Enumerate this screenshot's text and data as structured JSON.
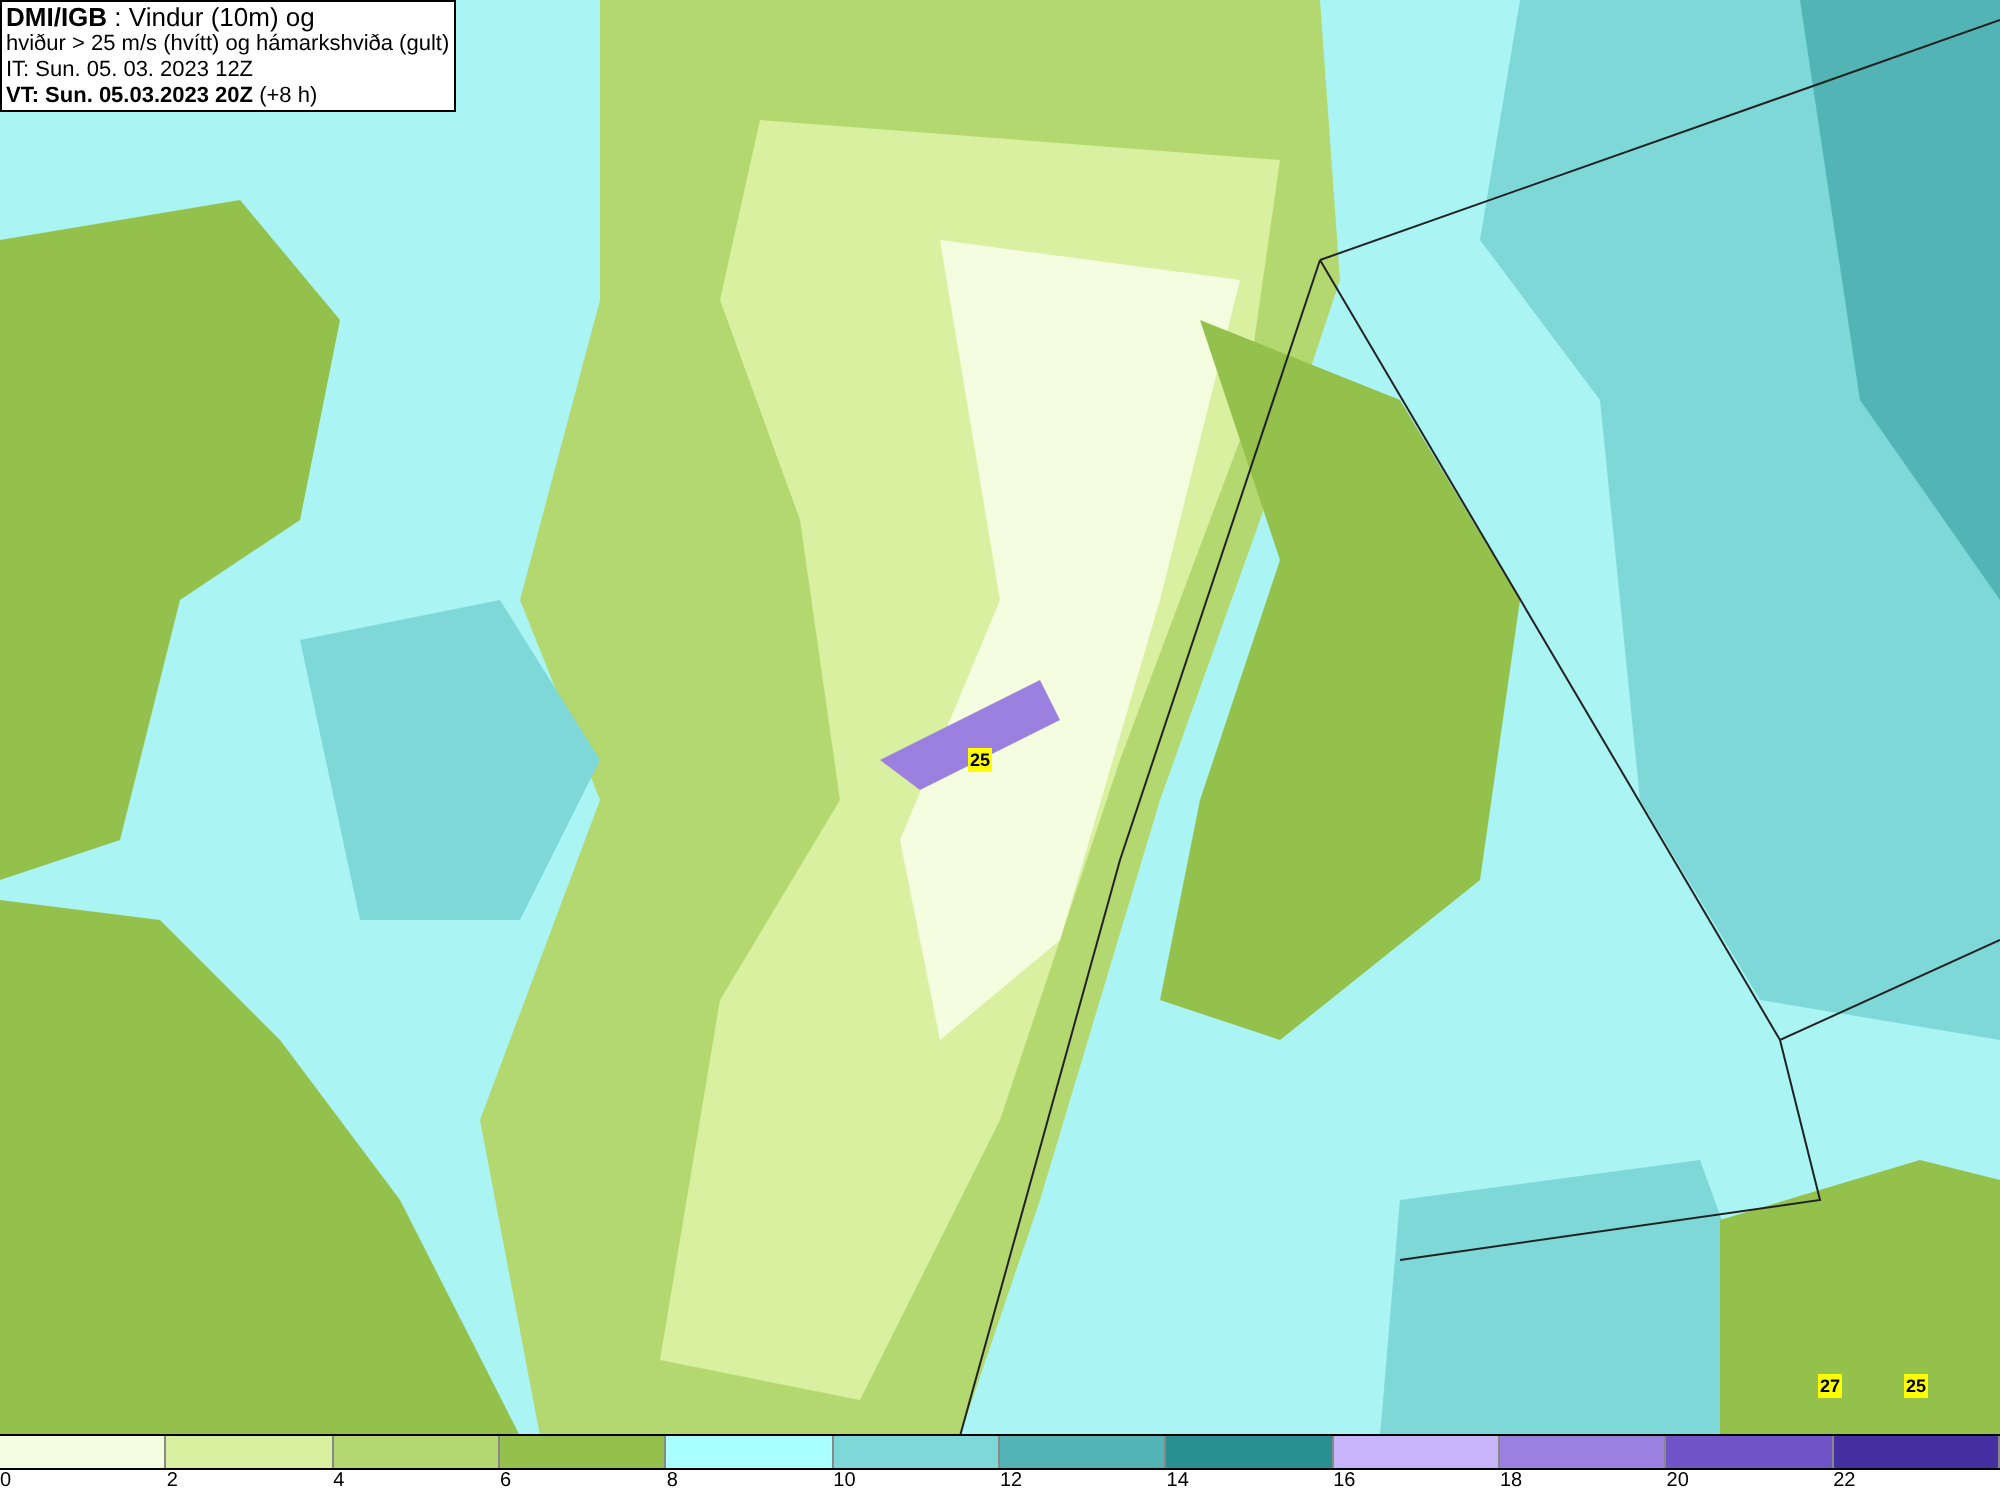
{
  "header": {
    "lines": [
      "**DMI/IGB** : Vindur (10m) og",
      "hviður > 25 m/s (hvítt) og hámarkshviða (gult)",
      "IT: Sun. 05. 03. 2023 12Z",
      "**VT: Sun. 05.03.2023 20Z** (+8 h)"
    ]
  },
  "gust_labels": [
    "25",
    "27",
    "25"
  ],
  "legend": {
    "bins": [
      {
        "color": "#f5fde0"
      },
      {
        "color": "#d8f0a0"
      },
      {
        "color": "#b4d870"
      },
      {
        "color": "#94c04c"
      },
      {
        "color": "#aaffff"
      },
      {
        "color": "#7ed8d8"
      },
      {
        "color": "#52b4b4"
      },
      {
        "color": "#289090"
      },
      {
        "color": "#c8b4f8"
      },
      {
        "color": "#9c80e0"
      },
      {
        "color": "#7054c8"
      },
      {
        "color": "#4430a0"
      }
    ],
    "ticks": [
      "0",
      "2",
      "4",
      "6",
      "8",
      "10",
      "12",
      "14",
      "16",
      "18",
      "20",
      "22"
    ]
  }
}
